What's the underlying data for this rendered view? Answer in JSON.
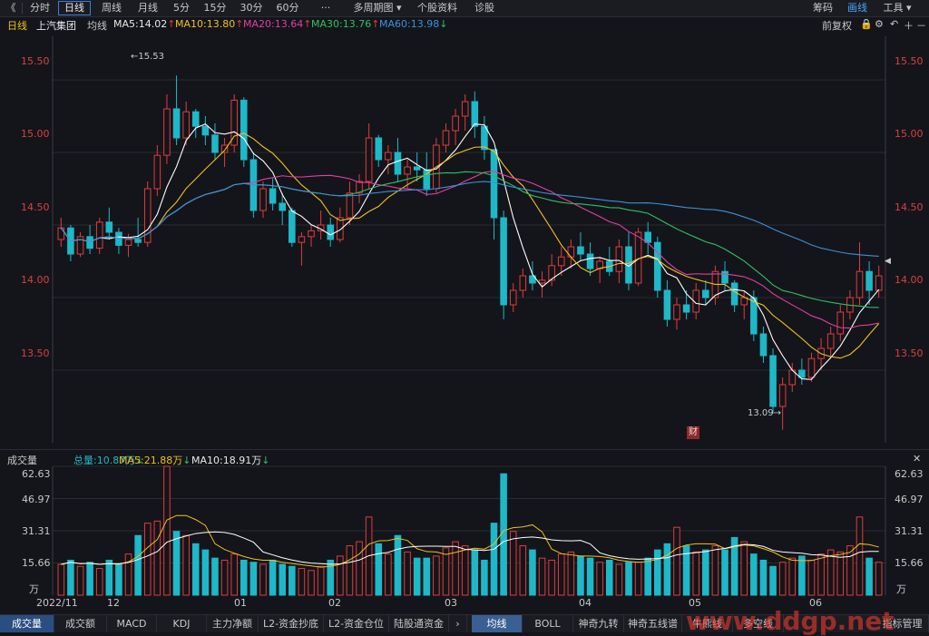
{
  "toolbar": {
    "back": "《",
    "items": [
      "分时",
      "日线",
      "周线",
      "月线",
      "5分",
      "15分",
      "30分",
      "60分",
      "···",
      "多周期图",
      "个股资料",
      "诊股"
    ],
    "right": [
      "筹码",
      "画线",
      "工具"
    ]
  },
  "mabar": {
    "period": "日线",
    "name": "上汽集团",
    "avg_label": "均线",
    "ma5": "MA5:14.02",
    "ma10": "MA10:13.80",
    "ma20": "MA20:13.64",
    "ma30": "MA30:13.76",
    "ma60": "MA60:13.98",
    "adjust": "前复权"
  },
  "price_axis": {
    "ticks": [
      "15.50",
      "15.00",
      "14.50",
      "14.00",
      "13.50"
    ]
  },
  "annotations": {
    "high": "15.53",
    "low": "13.09",
    "fin_mark": "财"
  },
  "volbar": {
    "label": "成交量",
    "total": "总量:10.87万",
    "ma5": "MA5:21.88万",
    "ma10": "MA10:18.91万"
  },
  "vol_axis": {
    "ticks": [
      "62.63",
      "46.97",
      "31.31",
      "15.66"
    ],
    "unit": "万"
  },
  "date_axis": [
    "2022/11",
    "12",
    "01",
    "02",
    "03",
    "04",
    "05",
    "06"
  ],
  "bottom_tabs": [
    "成交量",
    "成交额",
    "MACD",
    "KDJ",
    "主力净额",
    "L2-资金抄底",
    "L2-资金仓位",
    "陆股通资金",
    "均线",
    "BOLL",
    "神奇九转",
    "神奇五线谱",
    "牛熊线",
    "多空线",
    "指标管理"
  ],
  "watermark": "www.ddgp.net",
  "colors": {
    "up": "#e03c3c",
    "down": "#1eb8c8",
    "ma5": "#ffffff",
    "ma10": "#f0c020",
    "ma20": "#e040a0",
    "ma30": "#30c060",
    "ma60": "#3a90e0"
  },
  "chart_data": {
    "type": "candlestick",
    "y_range": [
      13.0,
      15.8
    ],
    "candles": [
      [
        14.4,
        14.55,
        14.35,
        14.48
      ],
      [
        14.48,
        14.5,
        14.25,
        14.3
      ],
      [
        14.3,
        14.45,
        14.28,
        14.42
      ],
      [
        14.42,
        14.5,
        14.3,
        14.34
      ],
      [
        14.34,
        14.55,
        14.3,
        14.52
      ],
      [
        14.52,
        14.62,
        14.4,
        14.45
      ],
      [
        14.45,
        14.48,
        14.3,
        14.36
      ],
      [
        14.36,
        14.44,
        14.28,
        14.4
      ],
      [
        14.4,
        14.55,
        14.35,
        14.38
      ],
      [
        14.38,
        14.8,
        14.35,
        14.75
      ],
      [
        14.75,
        15.05,
        14.7,
        14.98
      ],
      [
        14.98,
        15.4,
        14.92,
        15.3
      ],
      [
        15.3,
        15.53,
        15.05,
        15.1
      ],
      [
        15.1,
        15.35,
        15.05,
        15.28
      ],
      [
        15.28,
        15.3,
        15.1,
        15.18
      ],
      [
        15.18,
        15.25,
        15.05,
        15.12
      ],
      [
        15.12,
        15.2,
        14.95,
        15.0
      ],
      [
        15.0,
        15.1,
        14.9,
        15.05
      ],
      [
        15.05,
        15.4,
        15.0,
        15.36
      ],
      [
        15.36,
        15.38,
        14.9,
        14.95
      ],
      [
        14.95,
        15.0,
        14.55,
        14.6
      ],
      [
        14.6,
        14.8,
        14.55,
        14.75
      ],
      [
        14.75,
        14.82,
        14.6,
        14.65
      ],
      [
        14.65,
        14.72,
        14.5,
        14.6
      ],
      [
        14.6,
        14.62,
        14.35,
        14.38
      ],
      [
        14.38,
        14.45,
        14.22,
        14.42
      ],
      [
        14.42,
        14.5,
        14.35,
        14.46
      ],
      [
        14.46,
        14.6,
        14.4,
        14.5
      ],
      [
        14.5,
        14.55,
        14.35,
        14.4
      ],
      [
        14.4,
        14.62,
        14.38,
        14.55
      ],
      [
        14.55,
        14.8,
        14.5,
        14.72
      ],
      [
        14.72,
        14.85,
        14.65,
        14.8
      ],
      [
        14.8,
        15.2,
        14.75,
        15.1
      ],
      [
        15.1,
        15.12,
        14.9,
        14.95
      ],
      [
        14.95,
        15.05,
        14.85,
        15.0
      ],
      [
        15.0,
        15.1,
        14.8,
        14.85
      ],
      [
        14.85,
        14.95,
        14.75,
        14.9
      ],
      [
        14.9,
        15.0,
        14.8,
        14.88
      ],
      [
        14.88,
        15.0,
        14.7,
        14.75
      ],
      [
        14.75,
        15.1,
        14.72,
        15.05
      ],
      [
        15.05,
        15.2,
        15.0,
        15.15
      ],
      [
        15.15,
        15.3,
        15.05,
        15.25
      ],
      [
        15.25,
        15.4,
        15.15,
        15.35
      ],
      [
        15.35,
        15.42,
        15.1,
        15.18
      ],
      [
        15.18,
        15.25,
        14.95,
        15.02
      ],
      [
        15.02,
        14.95,
        14.4,
        14.55
      ],
      [
        14.55,
        14.6,
        13.85,
        13.95
      ],
      [
        13.95,
        14.1,
        13.9,
        14.05
      ],
      [
        14.05,
        14.2,
        14.0,
        14.15
      ],
      [
        14.15,
        14.25,
        14.05,
        14.1
      ],
      [
        14.1,
        14.18,
        14.0,
        14.12
      ],
      [
        14.12,
        14.3,
        14.08,
        14.22
      ],
      [
        14.22,
        14.35,
        14.15,
        14.28
      ],
      [
        14.28,
        14.4,
        14.2,
        14.35
      ],
      [
        14.35,
        14.45,
        14.25,
        14.3
      ],
      [
        14.3,
        14.38,
        14.15,
        14.2
      ],
      [
        14.2,
        14.28,
        14.1,
        14.25
      ],
      [
        14.25,
        14.35,
        14.15,
        14.18
      ],
      [
        14.18,
        14.4,
        14.1,
        14.35
      ],
      [
        14.35,
        14.45,
        14.05,
        14.1
      ],
      [
        14.1,
        14.48,
        14.08,
        14.45
      ],
      [
        14.45,
        14.52,
        14.3,
        14.38
      ],
      [
        14.38,
        14.42,
        14.0,
        14.05
      ],
      [
        14.05,
        14.12,
        13.8,
        13.85
      ],
      [
        13.85,
        14.0,
        13.78,
        13.95
      ],
      [
        13.95,
        14.05,
        13.85,
        13.9
      ],
      [
        13.9,
        14.1,
        13.85,
        14.05
      ],
      [
        14.05,
        14.12,
        13.95,
        14.0
      ],
      [
        14.0,
        14.22,
        13.95,
        14.18
      ],
      [
        14.18,
        14.25,
        14.05,
        14.1
      ],
      [
        14.1,
        14.12,
        13.9,
        13.95
      ],
      [
        13.95,
        14.05,
        13.85,
        14.0
      ],
      [
        14.0,
        14.05,
        13.7,
        13.75
      ],
      [
        13.75,
        13.8,
        13.55,
        13.6
      ],
      [
        13.6,
        13.65,
        13.2,
        13.25
      ],
      [
        13.25,
        13.45,
        13.09,
        13.4
      ],
      [
        13.4,
        13.55,
        13.35,
        13.5
      ],
      [
        13.5,
        13.58,
        13.4,
        13.45
      ],
      [
        13.45,
        13.62,
        13.42,
        13.58
      ],
      [
        13.58,
        13.72,
        13.5,
        13.65
      ],
      [
        13.65,
        13.8,
        13.58,
        13.75
      ],
      [
        13.75,
        13.95,
        13.7,
        13.9
      ],
      [
        13.9,
        14.05,
        13.85,
        14.0
      ],
      [
        14.0,
        14.38,
        13.95,
        14.18
      ],
      [
        14.18,
        14.25,
        13.95,
        14.05
      ],
      [
        14.05,
        14.22,
        14.0,
        14.15
      ]
    ],
    "volumes": [
      15,
      17,
      14,
      16,
      13,
      17,
      15,
      20,
      29,
      35,
      36,
      62.63,
      31,
      29,
      25,
      22,
      18,
      17,
      20,
      17,
      16,
      15,
      17,
      15,
      14,
      13,
      12,
      14,
      17,
      19,
      24,
      26,
      38,
      25,
      20,
      29,
      21,
      18,
      18,
      19,
      23,
      26,
      24,
      22,
      17,
      35,
      59,
      31,
      24,
      22,
      18,
      17,
      20,
      21,
      19,
      18,
      16,
      17,
      15,
      16,
      16,
      18,
      22,
      25,
      33,
      24,
      21,
      22,
      24,
      22,
      28,
      26,
      20,
      17,
      14,
      16,
      18,
      19,
      17,
      20,
      22,
      21,
      24,
      38,
      18,
      16
    ],
    "price_labels": [
      "15.50",
      "15.00",
      "14.50",
      "14.00",
      "13.50"
    ],
    "vol_labels": [
      "62.63",
      "46.97",
      "31.31",
      "15.66"
    ],
    "x_labels": [
      "2022/11",
      "12",
      "01",
      "02",
      "03",
      "04",
      "05",
      "06"
    ],
    "series": [
      {
        "name": "MA5",
        "value": "14.02"
      },
      {
        "name": "MA10",
        "value": "13.80"
      },
      {
        "name": "MA20",
        "value": "13.64"
      },
      {
        "name": "MA30",
        "value": "13.76"
      },
      {
        "name": "MA60",
        "value": "13.98"
      }
    ]
  }
}
